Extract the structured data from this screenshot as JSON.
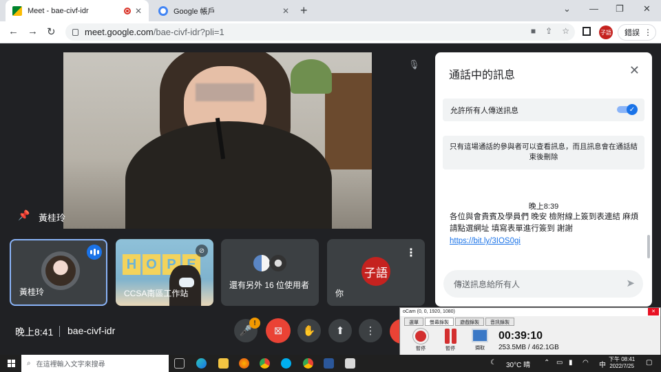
{
  "browser": {
    "tabs": [
      {
        "label": "Meet - bae-civf-idr",
        "active": true
      },
      {
        "label": "Google 帳戶",
        "active": false
      }
    ],
    "url_domain": "meet.google.com",
    "url_path": "/bae-civf-idr?pli=1",
    "profile_initials": "子語",
    "error_label": "錯誤"
  },
  "meet": {
    "main_speaker": "黃桂玲",
    "tiles": [
      {
        "name": "黃桂玲"
      },
      {
        "name": "CCSA南區工作站"
      },
      {
        "name": "還有另外 16 位使用者"
      },
      {
        "name": "你",
        "avatar_text": "子語"
      }
    ],
    "hope_letters": [
      "H",
      "O",
      "P",
      "E"
    ],
    "time": "晚上8:41",
    "meeting_code": "bae-civf-idr",
    "warning_badge": "!"
  },
  "chat": {
    "title": "通話中的訊息",
    "allow_label": "允許所有人傳送訊息",
    "allow_enabled": true,
    "info_text": "只有這場通話的參與者可以查看訊息，而且訊息會在通話結束後刪除",
    "message_time": "晚上8:39",
    "message_text": "各位與會貴賓及學員們 晚安 檢附線上簽到表連結 麻煩請點選網址 填寫表單進行簽到 謝謝",
    "message_link": "https://bit.ly/3IOS0gi",
    "input_placeholder": "傳送訊息給所有人"
  },
  "ocam": {
    "title": "oCam (0, 0, 1920, 1080)",
    "tabs": [
      "選單",
      "螢幕錄製",
      "遊戲錄製",
      "音訊錄製"
    ],
    "buttons": [
      "暫停",
      "暫停",
      "擷取"
    ],
    "timer": "00:39:10",
    "size": "253.5MB / 462.1GB"
  },
  "taskbar": {
    "search_placeholder": "在這裡輸入文字來搜尋",
    "weather": "30°C 晴",
    "ime": "中",
    "clock_time": "下午 08:41",
    "clock_date": "2022/7/25"
  },
  "colors": {
    "meet_bg": "#202124",
    "tile_bg": "#3c4043",
    "accent_blue": "#1a73e8",
    "end_call_red": "#ea4335"
  }
}
